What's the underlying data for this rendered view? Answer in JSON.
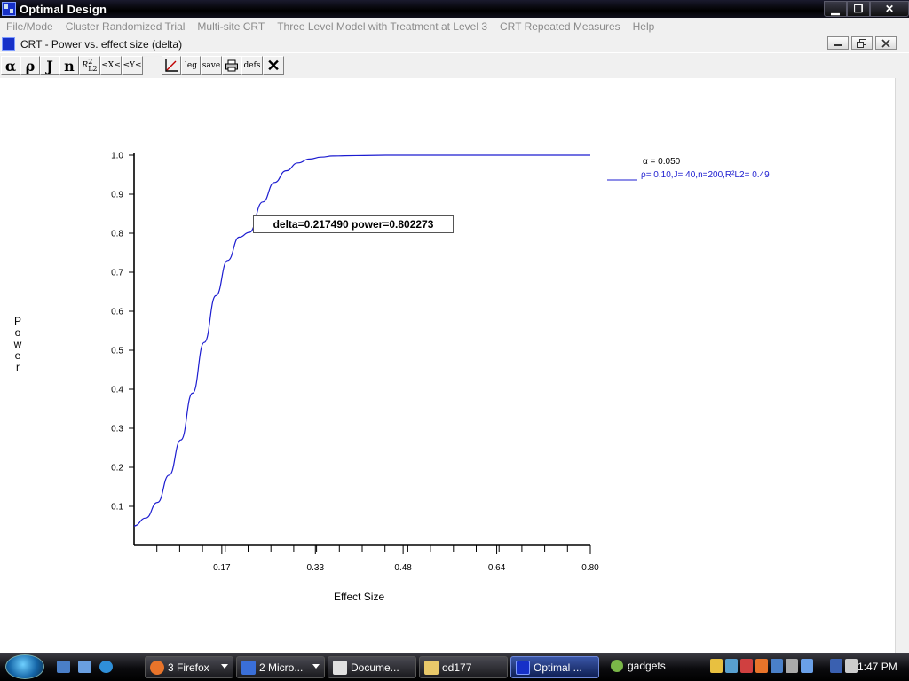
{
  "window": {
    "title": "Optimal Design",
    "controls": {
      "minimize": "▁",
      "maximize": "❐",
      "close": "✕"
    }
  },
  "menu": [
    "File/Mode",
    "Cluster Randomized Trial",
    "Multi-site CRT",
    "Three Level Model with Treatment at Level 3",
    "CRT Repeated Measures",
    "Help"
  ],
  "child": {
    "title": "CRT - Power vs. effect size (delta)"
  },
  "toolbar": {
    "alpha": "α",
    "rho": "ρ",
    "J": "J",
    "n": "n",
    "r2_base": "R",
    "r2_sub": "L2",
    "r2_sup": "2",
    "range1": "≤X≤",
    "range2": "≤Y≤",
    "axes_icon": "axes-icon",
    "leg": "leg",
    "save": "save",
    "print_icon": "printer-icon",
    "defs": "defs",
    "close": "✕"
  },
  "chart_data": {
    "type": "line",
    "xlabel": "Effect Size",
    "ylabel": "Power",
    "xlim": [
      0.02,
      0.8
    ],
    "ylim": [
      0.0,
      1.0
    ],
    "xticks": [
      0.17,
      0.33,
      0.48,
      0.64,
      0.8
    ],
    "xtick_labels": [
      "0.17",
      "0.33",
      "0.48",
      "0.64",
      "0.80"
    ],
    "yticks": [
      0.1,
      0.2,
      0.3,
      0.4,
      0.5,
      0.6,
      0.7,
      0.8,
      0.9,
      1.0
    ],
    "ytick_labels": [
      "0.1",
      "0.2",
      "0.3",
      "0.4",
      "0.5",
      "0.6",
      "0.7",
      "0.8",
      "0.9",
      "1.0"
    ],
    "grid": false,
    "legend_position": "right",
    "alpha_text": "α = 0.050",
    "series": [
      {
        "name": "ρ= 0.10,J= 40,n=200,R²L2= 0.49",
        "color": "#1c1cd0",
        "x": [
          0.02,
          0.04,
          0.06,
          0.08,
          0.1,
          0.12,
          0.14,
          0.16,
          0.18,
          0.2,
          0.217,
          0.24,
          0.26,
          0.28,
          0.3,
          0.32,
          0.34,
          0.36,
          0.4,
          0.45,
          0.5,
          0.6,
          0.7,
          0.8
        ],
        "y": [
          0.05,
          0.07,
          0.11,
          0.18,
          0.27,
          0.39,
          0.52,
          0.64,
          0.73,
          0.79,
          0.802,
          0.88,
          0.93,
          0.96,
          0.98,
          0.99,
          0.995,
          0.998,
          0.999,
          1.0,
          1.0,
          1.0,
          1.0,
          1.0
        ]
      }
    ],
    "annotation": "delta=0.217490 power=0.802273"
  },
  "taskbar": {
    "items": [
      {
        "label": "3 Firefox",
        "color": "#e8742a"
      },
      {
        "label": "2 Micro...",
        "color": "#3a6fd8"
      },
      {
        "label": "Docume...",
        "color": "#e0e0e0"
      },
      {
        "label": "od177",
        "color": "#e8c86a"
      },
      {
        "label": "Optimal ...",
        "color": "#1630c8"
      }
    ],
    "gadgets": "gadgets",
    "clock": "1:47 PM"
  }
}
